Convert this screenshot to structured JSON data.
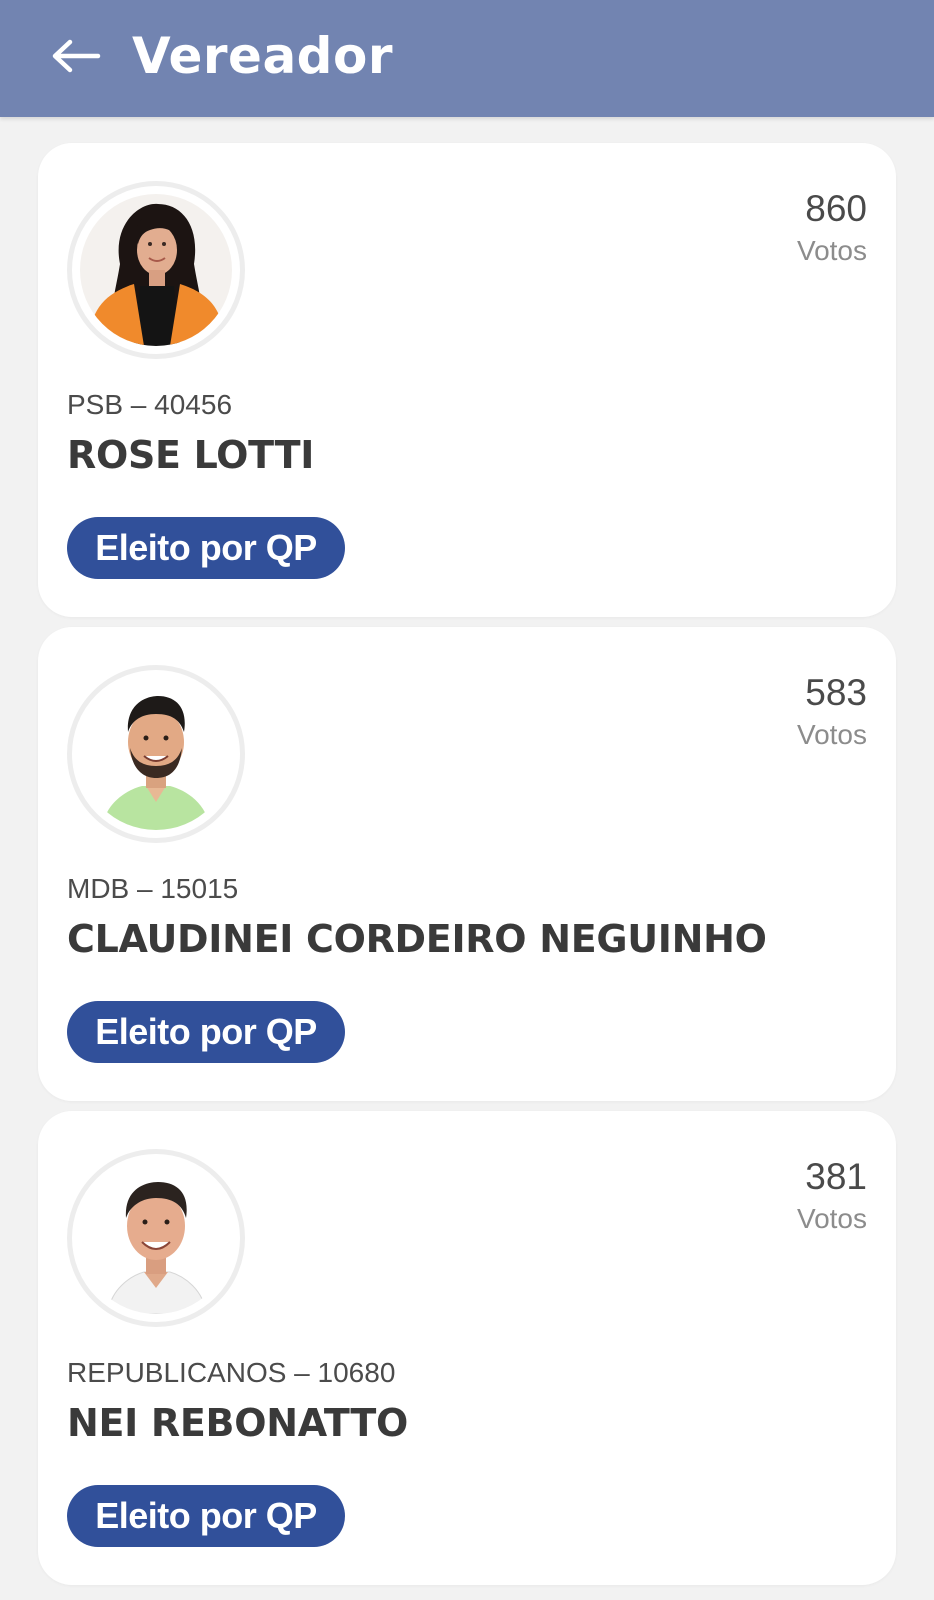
{
  "header": {
    "title": "Vereador",
    "back_icon": "arrow-left-icon",
    "background": "#7284b1"
  },
  "candidates": [
    {
      "votes": "860",
      "votes_label": "Votos",
      "party_number": "PSB – 40456",
      "name": "ROSE LOTTI",
      "status": "Eleito por QP",
      "photo": "candidate-photo-woman-orange-jacket"
    },
    {
      "votes": "583",
      "votes_label": "Votos",
      "party_number": "MDB – 15015",
      "name": "CLAUDINEI CORDEIRO NEGUINHO",
      "status": "Eleito por QP",
      "photo": "candidate-photo-man-green-shirt"
    },
    {
      "votes": "381",
      "votes_label": "Votos",
      "party_number": "REPUBLICANOS – 10680",
      "name": "NEI REBONATTO",
      "status": "Eleito por QP",
      "photo": "candidate-photo-man-white-shirt"
    }
  ],
  "colors": {
    "badge": "#31509a",
    "card": "#ffffff",
    "page_background": "#f2f2f2"
  }
}
